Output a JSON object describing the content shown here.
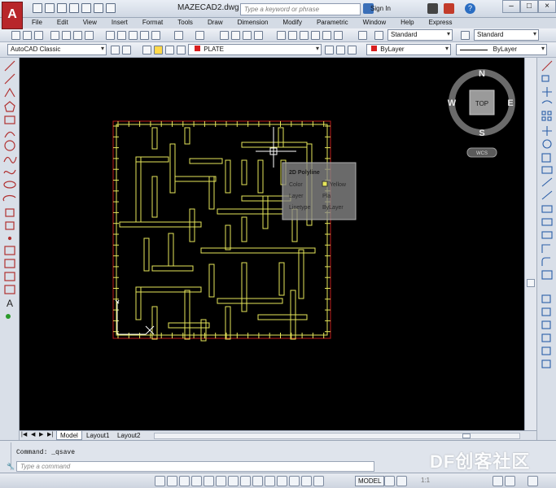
{
  "title_bar": {
    "document_title": "MAZECAD2.dwg",
    "search_placeholder": "Type a keyword or phrase",
    "sign_in": "Sign In",
    "app_logo": "A"
  },
  "menu": [
    "File",
    "Edit",
    "View",
    "Insert",
    "Format",
    "Tools",
    "Draw",
    "Dimension",
    "Modify",
    "Parametric",
    "Window",
    "Help",
    "Express"
  ],
  "toolbar1": {
    "text_style": "Standard",
    "dim_style": "Standard"
  },
  "toolbar2": {
    "workspace": "AutoCAD Classic",
    "layer": "PLATE",
    "color": "ByLayer",
    "linetype": "ByLayer"
  },
  "viewcube": {
    "north": "N",
    "south": "S",
    "east": "E",
    "west": "W",
    "face": "TOP",
    "ucs": "WCS"
  },
  "tooltip": {
    "title": "2D Polyline",
    "rows": [
      {
        "label": "Color",
        "value": "Yellow"
      },
      {
        "label": "Layer",
        "value": "Pla"
      },
      {
        "label": "Linetype",
        "value": "ByLayer"
      }
    ]
  },
  "layout_tabs": [
    "Model",
    "Layout1",
    "Layout2"
  ],
  "command": {
    "history": "Command:  _qsave",
    "placeholder": "Type a command"
  },
  "status": {
    "model": "MODEL",
    "scale": "1:1"
  },
  "watermark": "DF创客社区",
  "colors": {
    "maze": "#e6e65a",
    "border": "#c01c1c",
    "canvas": "#000000"
  }
}
